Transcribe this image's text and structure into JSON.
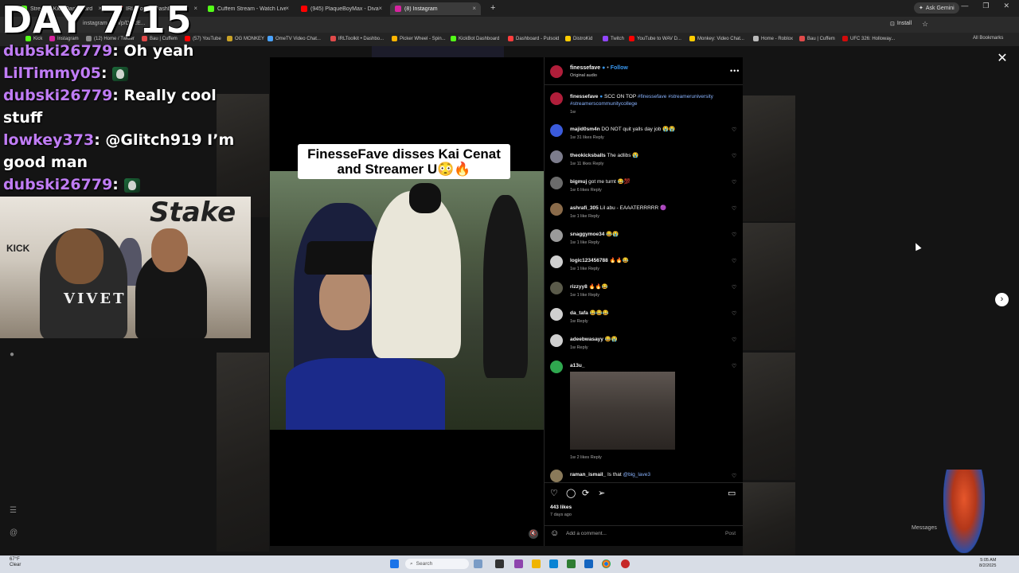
{
  "overlay": {
    "day_counter": "DAY 7/15",
    "chat": [
      {
        "user": "dubski26779",
        "color": "#bf7cf4",
        "text": "Oh yeah",
        "emote": false
      },
      {
        "user": "LilTimmy05",
        "color": "#c07cf6",
        "text": "",
        "emote": true
      },
      {
        "user": "dubski26779",
        "color": "#bf7cf4",
        "text": "Really cool stuff",
        "emote": false
      },
      {
        "user": "lowkey373",
        "color": "#c07cf6",
        "text": "@Glitch919 I’m good man",
        "emote": false
      },
      {
        "user": "dubski26779",
        "color": "#bf7cf4",
        "text": "",
        "emote": true
      },
      {
        "user": "dubski26779",
        "color": "#bf7cf4",
        "text": "",
        "emote": false
      }
    ],
    "webcam": {
      "brand": "Stake",
      "shirt_text": "VIVET",
      "kick_text": "KICK"
    }
  },
  "browser": {
    "tabs": [
      {
        "label": "Stream - Kick Dashboard",
        "color": "#53fc18",
        "active": false
      },
      {
        "label": "IRLToolkit - Dashboard",
        "color": "#e04a4a",
        "active": false
      },
      {
        "label": "Cuffem Stream - Watch Live on...",
        "color": "#53fc18",
        "active": false
      },
      {
        "label": "(945) PlaqueBoyMax - Diva (Of...",
        "color": "#ff0000",
        "active": false
      },
      {
        "label": "(8) Instagram",
        "color": "#d6249f",
        "active": true
      }
    ],
    "url": "instagram.com/p/DMcE...",
    "ask_gemini": "Ask Gemini",
    "install": "Install",
    "bookmarks": [
      {
        "label": "Kick",
        "color": "#53fc18"
      },
      {
        "label": "Instagram",
        "color": "#d6249f"
      },
      {
        "label": "(12) Home / Twitter",
        "color": "#888"
      },
      {
        "label": "Bau | Cuffem",
        "color": "#e04a4a"
      },
      {
        "label": "(57) YouTube",
        "color": "#ff0000"
      },
      {
        "label": "OG MONKEY",
        "color": "#c9a227"
      },
      {
        "label": "OmeTV Video Chat...",
        "color": "#4aa3ff"
      },
      {
        "label": "IRLToolkit • Dashbo...",
        "color": "#e04a4a"
      },
      {
        "label": "Picker Wheel - Spin...",
        "color": "#ffb400"
      },
      {
        "label": "KickBot Dashboard",
        "color": "#53fc18"
      },
      {
        "label": "Dashboard - Pulsoid",
        "color": "#ff3d3d"
      },
      {
        "label": "DistroKid",
        "color": "#ffcc00"
      },
      {
        "label": "Twitch",
        "color": "#9146ff"
      },
      {
        "label": "YouTube to WAV D...",
        "color": "#ff0000"
      },
      {
        "label": "Monkey: Video Chat...",
        "color": "#ffcc00"
      },
      {
        "label": "Home - Roblox",
        "color": "#bbb"
      },
      {
        "label": "Bau | Cuffem",
        "color": "#e04a4a"
      },
      {
        "label": "UFC 326: Holloway...",
        "color": "#d20a0a"
      }
    ],
    "all_bookmarks": "All Bookmarks"
  },
  "post": {
    "video_caption": "FinesseFave disses Kai Cenat and Streamer U😳🔥",
    "author": "finessefave",
    "follow": "Follow",
    "audio": "Original audio",
    "caption_text": "SCC ON TOP",
    "caption_tags": "#finessefave #streameruniversity #streamerscommunitycollege",
    "caption_age": "1w",
    "comments": [
      {
        "user": "majid0sm4n",
        "text": "DO NOT quit yalls day job 😭😭",
        "age": "1w",
        "likes": "31 likes",
        "reply": "Reply",
        "avatar": "#3b5bdb"
      },
      {
        "user": "theokicksballs",
        "text": "The adlibs 😭",
        "age": "1w",
        "likes": "11 likes",
        "reply": "Reply",
        "avatar": "#7c7c8c"
      },
      {
        "user": "bigmuj",
        "text": "got me turnt 😂💯",
        "age": "1w",
        "likes": "6 likes",
        "reply": "Reply",
        "avatar": "#6b6b6b"
      },
      {
        "user": "ashrafi_305",
        "text": "Lil abu - EAAATERRRRR 🟣",
        "age": "1w",
        "likes": "1 like",
        "reply": "Reply",
        "avatar": "#8a6b4a"
      },
      {
        "user": "snaggymoe34",
        "text": "😂😭",
        "age": "1w",
        "likes": "1 like",
        "reply": "Reply",
        "avatar": "#9a9a9a"
      },
      {
        "user": "logic123456788",
        "text": "🔥🔥😂",
        "age": "1w",
        "likes": "1 like",
        "reply": "Reply",
        "avatar": "#cfcfcf"
      },
      {
        "user": "rizzyy8",
        "text": "🔥🔥😂",
        "age": "1w",
        "likes": "1 like",
        "reply": "Reply",
        "avatar": "#5a5a4a"
      },
      {
        "user": "da_tafa",
        "text": "😂😂😂",
        "age": "1w",
        "likes": "",
        "reply": "Reply",
        "avatar": "#cfcfcf"
      },
      {
        "user": "adeebwasayy",
        "text": "😂😭",
        "age": "1w",
        "likes": "",
        "reply": "Reply",
        "avatar": "#cfcfcf"
      },
      {
        "user": "a13u_",
        "text": "",
        "age": "1w",
        "likes": "2 likes",
        "reply": "Reply",
        "avatar": "#2fa84f"
      }
    ],
    "last_comment_user": "raman_ismail_",
    "last_comment_text": "Is that",
    "last_comment_tag": "@big_lave3",
    "likes_total": "443 likes",
    "post_age": "7 days ago",
    "comment_placeholder": "Add a comment...",
    "post_button": "Post"
  },
  "taskbar": {
    "weather_temp": "67°F",
    "weather_desc": "Clear",
    "search": "Search",
    "time": "5:05 AM",
    "date": "8/2/2025"
  },
  "misc": {
    "messages": "Messages"
  }
}
